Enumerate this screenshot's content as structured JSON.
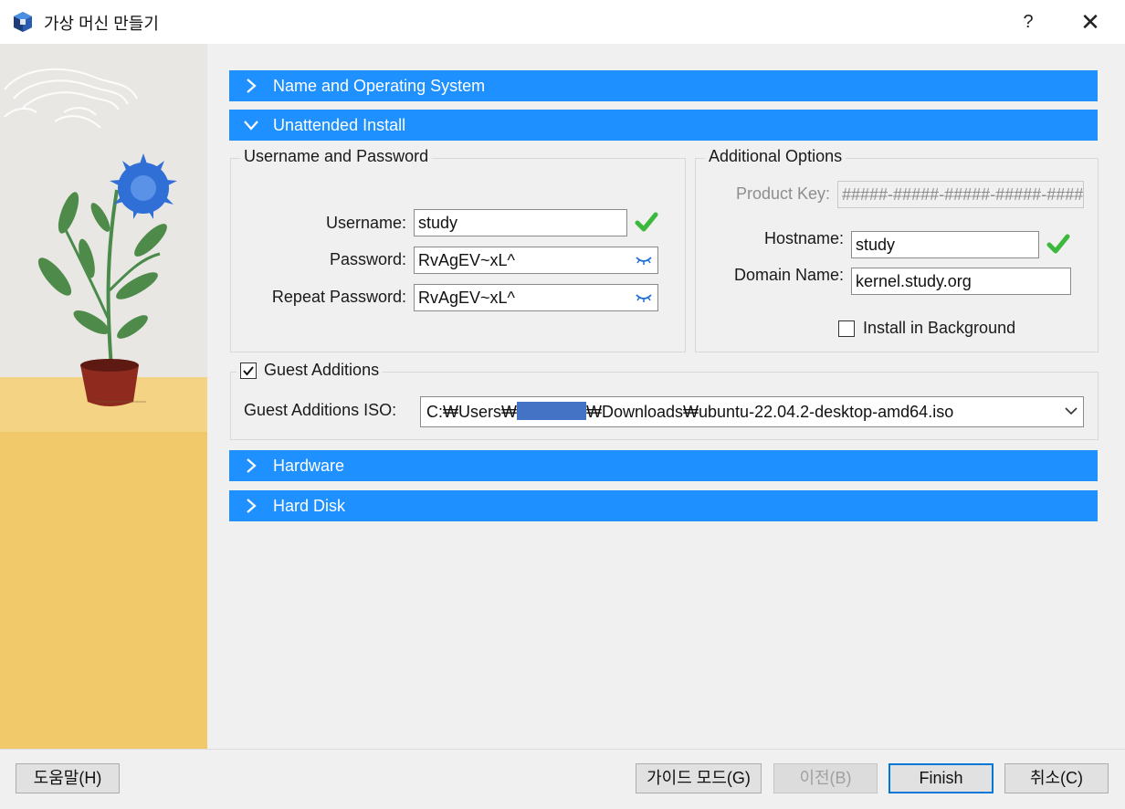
{
  "window": {
    "title": "가상 머신 만들기",
    "help_label": "?",
    "close_label": "✕"
  },
  "sections": {
    "name_os": "Name and Operating System",
    "unattended": "Unattended Install",
    "hardware": "Hardware",
    "hard_disk": "Hard Disk"
  },
  "credentials": {
    "group_title": "Username and Password",
    "username_label": "Username:",
    "username_value": "study",
    "password_label": "Password:",
    "password_value": "RvAgEV~xL^",
    "repeat_label": "Repeat Password:",
    "repeat_value": "RvAgEV~xL^"
  },
  "additional": {
    "group_title": "Additional Options",
    "product_key_label": "Product Key:",
    "product_key_value": "#####-#####-#####-#####-#####",
    "hostname_label": "Hostname:",
    "hostname_value": "study",
    "domain_label": "Domain Name:",
    "domain_value": "kernel.study.org",
    "install_bg_label": "Install in Background",
    "install_bg_checked": false
  },
  "guest": {
    "checkbox_label": "Guest Additions",
    "checked": true,
    "iso_label": "Guest Additions ISO:",
    "iso_prefix": "C:₩Users₩",
    "iso_suffix": "₩Downloads₩ubuntu-22.04.2-desktop-amd64.iso"
  },
  "buttons": {
    "help": "도움말(H)",
    "guided": "가이드 모드(G)",
    "back": "이전(B)",
    "finish": "Finish",
    "cancel": "취소(C)"
  },
  "colors": {
    "section_header": "#1e90ff",
    "valid_check": "#3cb93c",
    "default_button_border": "#0078d7"
  },
  "icons": [
    "virtualbox-icon",
    "chevron-right-icon",
    "chevron-down-icon",
    "checkmark-icon",
    "eye-closed-icon",
    "dropdown-arrow-icon"
  ]
}
